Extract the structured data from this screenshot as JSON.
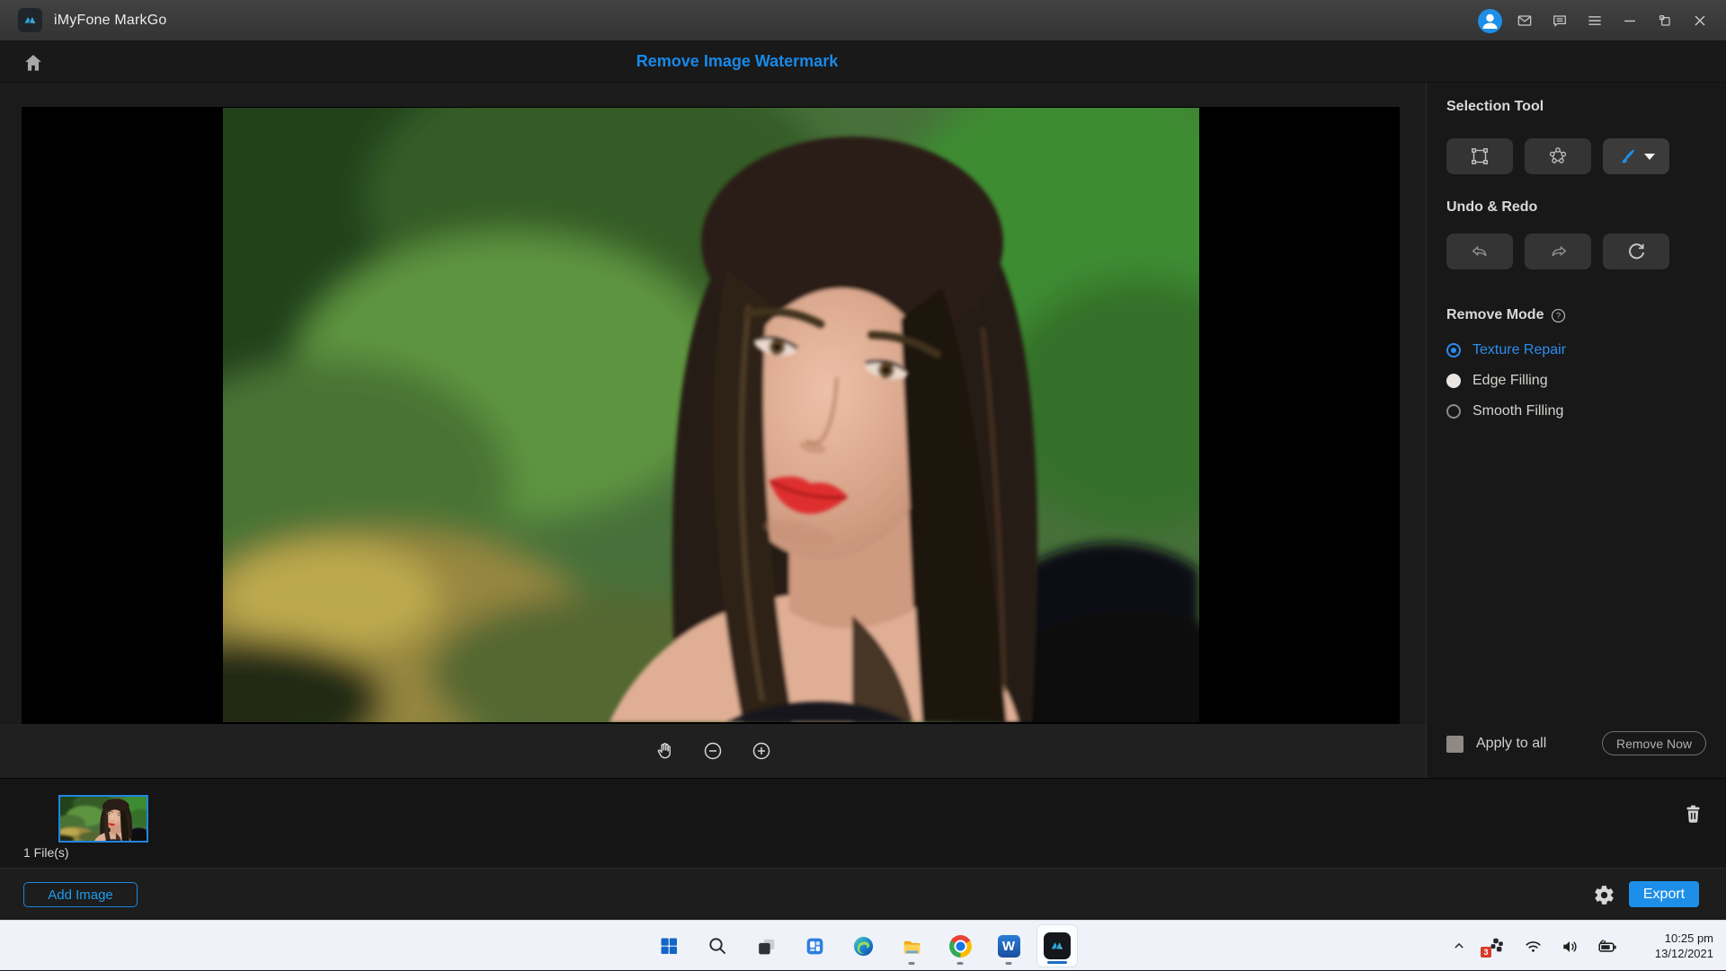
{
  "app": {
    "title": "iMyFone MarkGo"
  },
  "titlebar": {
    "icons": [
      "account",
      "mail",
      "message",
      "menu",
      "minimize",
      "restore",
      "close"
    ]
  },
  "header": {
    "title": "Remove Image Watermark",
    "accent_color": "#1789E8"
  },
  "right_panel": {
    "selection_tool": {
      "heading": "Selection Tool",
      "tools": [
        "rect-select",
        "polygon-select",
        "brush-select"
      ],
      "active_tool": "brush-select"
    },
    "undo_redo": {
      "heading": "Undo & Redo",
      "buttons": [
        "undo",
        "redo",
        "reset"
      ]
    },
    "remove_mode": {
      "heading": "Remove Mode",
      "help_icon": "help-circle",
      "selected_color": "#2D8CF0",
      "options": [
        {
          "label": "Texture Repair",
          "state": "selected"
        },
        {
          "label": "Edge Filling",
          "state": "normal"
        },
        {
          "label": "Smooth Filling",
          "state": "normal"
        }
      ]
    },
    "apply_row": {
      "checkbox_label": "Apply to all",
      "checked": false,
      "button_label": "Remove Now"
    }
  },
  "canvas": {
    "controls": [
      "pan",
      "zoom-out",
      "zoom-in"
    ]
  },
  "filmstrip": {
    "file_count_label": "1 File(s)",
    "thumbnail_selected": true,
    "trash_icon": "trash"
  },
  "footer": {
    "add_image_label": "Add Image",
    "settings_icon": "gear",
    "export_label": "Export",
    "export_color": "#1D8FE8"
  },
  "taskbar": {
    "apps": [
      {
        "name": "start"
      },
      {
        "name": "search"
      },
      {
        "name": "task-view"
      },
      {
        "name": "widgets"
      },
      {
        "name": "edge"
      },
      {
        "name": "file-explorer",
        "running": true
      },
      {
        "name": "chrome",
        "running": true
      },
      {
        "name": "word",
        "running": true
      },
      {
        "name": "markgo",
        "running": true,
        "active": true
      }
    ],
    "tray": {
      "hidden_icons_icon": "chevron-up",
      "badge_count": "3",
      "icons": [
        "notification-app",
        "wifi",
        "volume",
        "battery-charging"
      ],
      "time": "10:25 pm",
      "date": "13/12/2021"
    }
  }
}
